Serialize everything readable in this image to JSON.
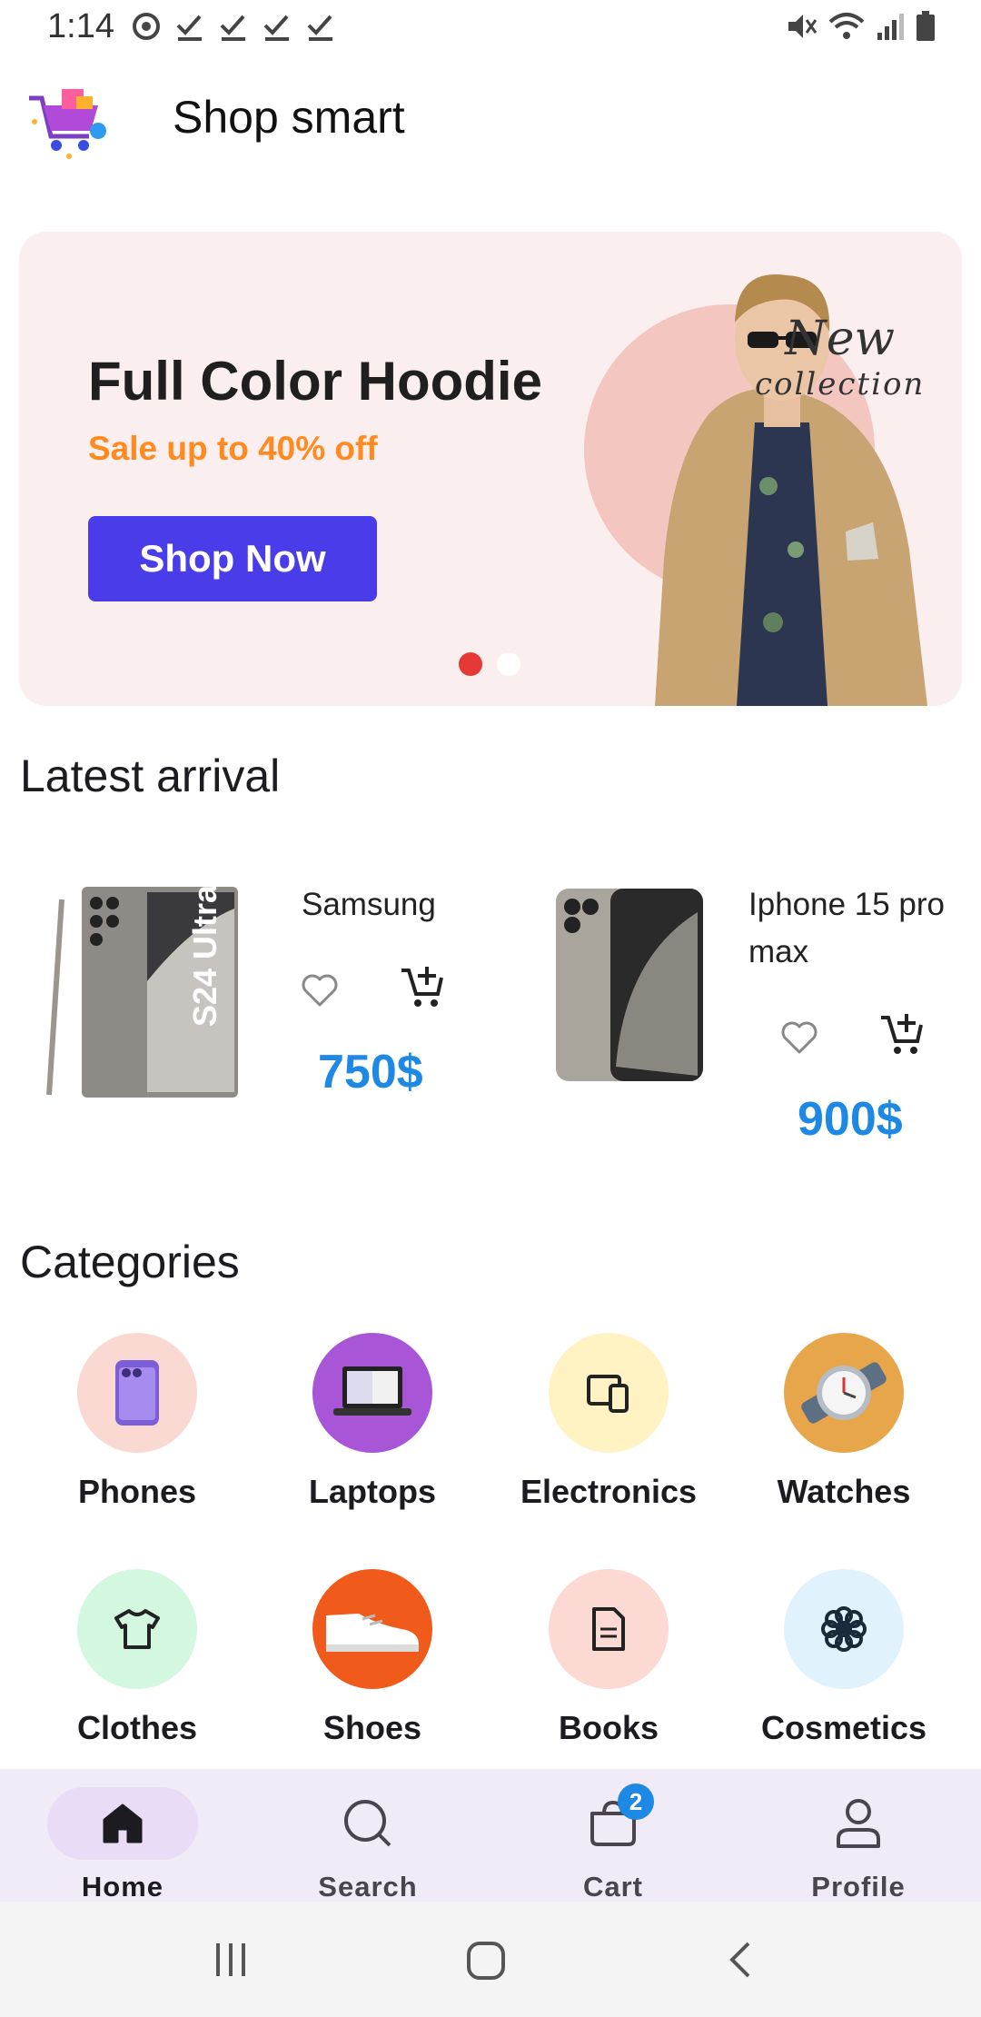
{
  "status_bar": {
    "time": "1:14"
  },
  "app": {
    "title": "Shop smart",
    "logo_icon": "shopping-cart-logo-icon"
  },
  "banner": {
    "title": "Full Color Hoodie",
    "subtitle": "Sale up to 40% off",
    "button_label": "Shop Now",
    "overlay_line1": "New",
    "overlay_line2": "collection",
    "active_dot_color": "#e53935"
  },
  "latest_arrival": {
    "title": "Latest arrival",
    "products": [
      {
        "name": "Samsung",
        "price": "750$",
        "image_text": "S24 Ultra"
      },
      {
        "name": "Iphone 15 pro max",
        "price": "900$"
      }
    ]
  },
  "categories": {
    "title": "Categories",
    "items": [
      {
        "label": "Phones",
        "icon": "phone-icon",
        "bg": "#fbd9d3"
      },
      {
        "label": "Laptops",
        "icon": "laptop-icon",
        "bg": "#a855d8"
      },
      {
        "label": "Electronics",
        "icon": "devices-icon",
        "bg": "#fff3c4"
      },
      {
        "label": "Watches",
        "icon": "watch-icon",
        "bg": "#e8a64a"
      },
      {
        "label": "Clothes",
        "icon": "shirt-icon",
        "bg": "#d3f8df"
      },
      {
        "label": "Shoes",
        "icon": "shoe-icon",
        "bg": "#f05a1a"
      },
      {
        "label": "Books",
        "icon": "document-icon",
        "bg": "#fcd9d3"
      },
      {
        "label": "Cosmetics",
        "icon": "flower-icon",
        "bg": "#e0f2fc"
      }
    ]
  },
  "bottom_nav": {
    "items": [
      {
        "label": "Home",
        "icon": "home-icon"
      },
      {
        "label": "Search",
        "icon": "search-icon"
      },
      {
        "label": "Cart",
        "icon": "cart-bag-icon",
        "badge": "2"
      },
      {
        "label": "Profile",
        "icon": "profile-icon"
      }
    ]
  }
}
